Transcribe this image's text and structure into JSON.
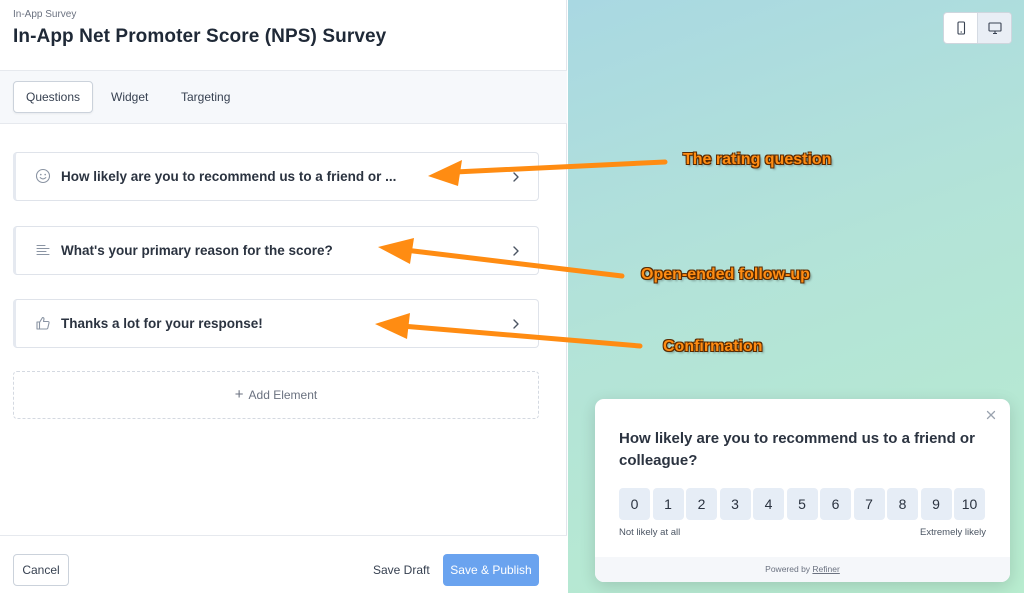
{
  "header": {
    "breadcrumb": "In-App Survey",
    "title": "In-App Net Promoter Score (NPS) Survey"
  },
  "tabs": [
    {
      "label": "Questions",
      "active": true
    },
    {
      "label": "Widget",
      "active": false
    },
    {
      "label": "Targeting",
      "active": false
    }
  ],
  "elements": [
    {
      "icon": "smiley-icon",
      "label": "How likely are you to recommend us to a friend or ..."
    },
    {
      "icon": "text-lines-icon",
      "label": "What's your primary reason for the score?"
    },
    {
      "icon": "thumbs-up-icon",
      "label": "Thanks a lot for your response!"
    }
  ],
  "add_element": {
    "label": "Add Element",
    "icon": "plus-icon"
  },
  "footer": {
    "cancel_label": "Cancel",
    "save_draft_label": "Save Draft",
    "publish_label": "Save & Publish"
  },
  "device_switch": {
    "options": [
      "mobile-icon",
      "desktop-icon"
    ],
    "selected": "desktop-icon"
  },
  "annotations": {
    "rating": "The rating question",
    "followup": "Open-ended follow-up",
    "confirmation": "Confirmation"
  },
  "widget": {
    "question": "How likely are you to recommend us to a friend or colleague?",
    "scale": [
      "0",
      "1",
      "2",
      "3",
      "4",
      "5",
      "6",
      "7",
      "8",
      "9",
      "10"
    ],
    "low_label": "Not likely at all",
    "high_label": "Extremely likely",
    "powered_by": "Powered by",
    "powered_by_link": "Refiner"
  },
  "colors": {
    "accent": "#6aa3ef",
    "annotation": "#ff8c12",
    "preview_gradient_start": "#a9d8e2",
    "preview_gradient_end": "#b8eccf",
    "scale_button": "#e6edf6"
  }
}
